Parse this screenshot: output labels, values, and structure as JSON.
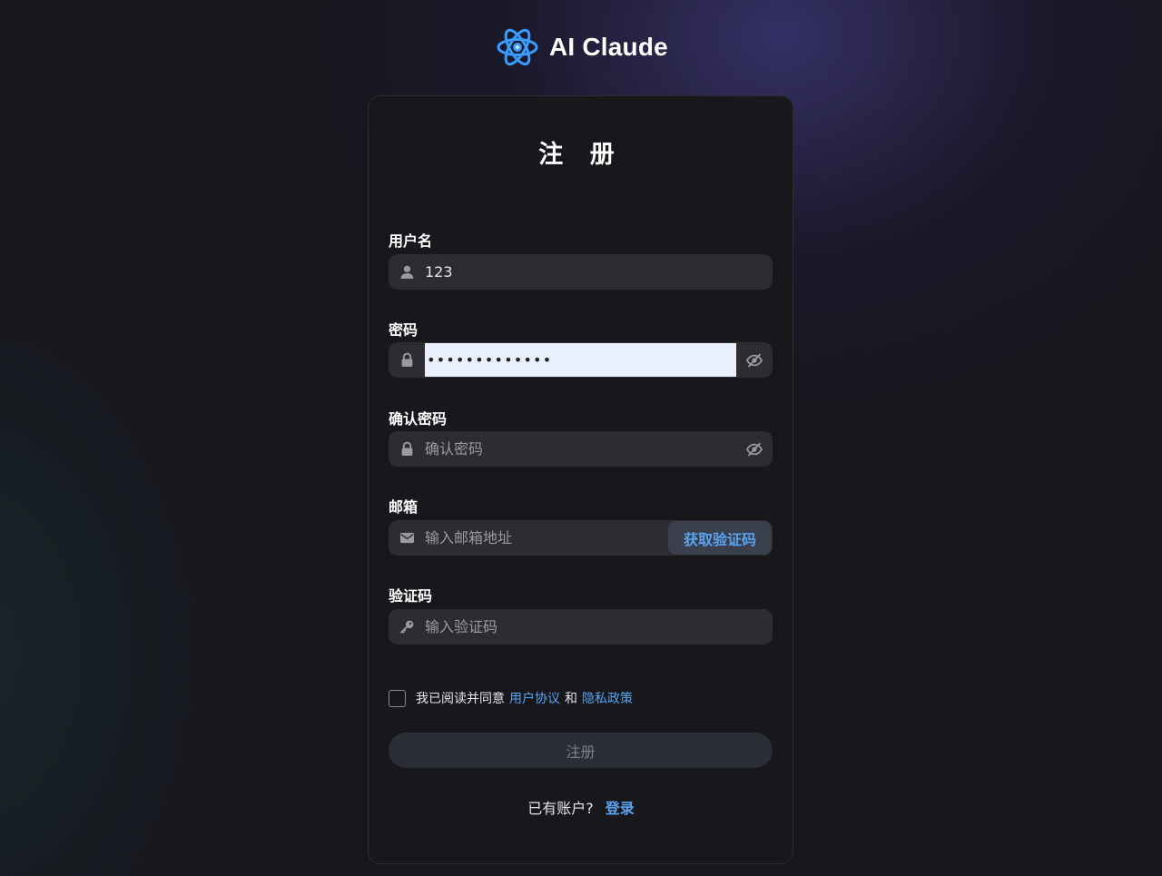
{
  "brand": {
    "name": "AI Claude",
    "logo_icon": "atom-logo-icon",
    "logo_color": "#3b9cff"
  },
  "form": {
    "title": "注 册",
    "username": {
      "label": "用户名",
      "value": "123",
      "icon": "user-icon"
    },
    "password": {
      "label": "密码",
      "value": "•••••••••••••",
      "icon": "lock-icon",
      "toggle_icon": "eye-off-icon"
    },
    "confirm_password": {
      "label": "确认密码",
      "placeholder": "确认密码",
      "icon": "lock-icon",
      "toggle_icon": "eye-off-icon"
    },
    "email": {
      "label": "邮箱",
      "placeholder": "输入邮箱地址",
      "icon": "mail-icon",
      "button": "获取验证码"
    },
    "code": {
      "label": "验证码",
      "placeholder": "输入验证码",
      "icon": "key-icon"
    },
    "agreement": {
      "prefix": "我已阅读并同意",
      "terms": "用户协议",
      "and": "和",
      "privacy": "隐私政策"
    },
    "submit_label": "注册",
    "footer": {
      "prompt": "已有账户?",
      "login_link": "登录"
    }
  },
  "colors": {
    "accent": "#5aa4f0",
    "card_bg": "#18181c",
    "field_bg": "#2c2c31",
    "autofill_bg": "#e8f0fe"
  }
}
